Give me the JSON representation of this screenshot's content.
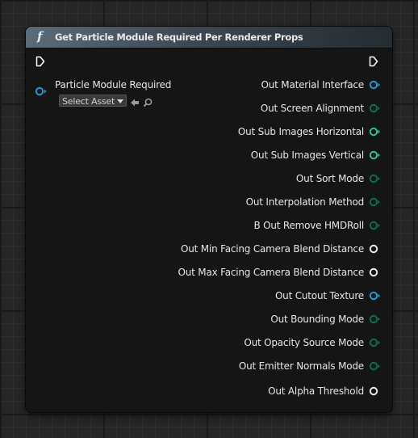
{
  "node": {
    "title": "Get Particle Module Required Per Renderer Props",
    "function_icon": "f",
    "input": {
      "label": "Particle Module Required",
      "asset_select_label": "Select Asset"
    },
    "outputs": [
      {
        "label": "Out Material Interface",
        "color": "#1a9ad6",
        "arrow": true
      },
      {
        "label": "Out Screen Alignment",
        "color": "#0b6b5a",
        "arrow": true
      },
      {
        "label": "Out Sub Images Horizontal",
        "color": "#2ec08e",
        "arrow": true
      },
      {
        "label": "Out Sub Images Vertical",
        "color": "#2ec08e",
        "arrow": true
      },
      {
        "label": "Out Sort Mode",
        "color": "#0b6b5a",
        "arrow": true
      },
      {
        "label": "Out Interpolation Method",
        "color": "#0b6b5a",
        "arrow": true
      },
      {
        "label": "B Out Remove HMDRoll",
        "color": "#0b6b5a",
        "arrow": true
      },
      {
        "label": "Out Min Facing Camera Blend Distance",
        "color": "#e8e8e8",
        "arrow": false
      },
      {
        "label": "Out Max Facing Camera Blend Distance",
        "color": "#e8e8e8",
        "arrow": false
      },
      {
        "label": "Out Cutout Texture",
        "color": "#1a9ad6",
        "arrow": true
      },
      {
        "label": "Out Bounding Mode",
        "color": "#0b6b5a",
        "arrow": true
      },
      {
        "label": "Out Opacity Source Mode",
        "color": "#0b6b5a",
        "arrow": true
      },
      {
        "label": "Out Emitter Normals Mode",
        "color": "#0b6b5a",
        "arrow": true
      },
      {
        "label": "Out Alpha Threshold",
        "color": "#e8e8e8",
        "arrow": false
      }
    ],
    "icons": {
      "exec_in": "exec-input-pin-icon",
      "exec_out": "exec-output-pin-icon",
      "use_selected": "arrow-left-icon",
      "browse": "magnifier-icon"
    }
  }
}
